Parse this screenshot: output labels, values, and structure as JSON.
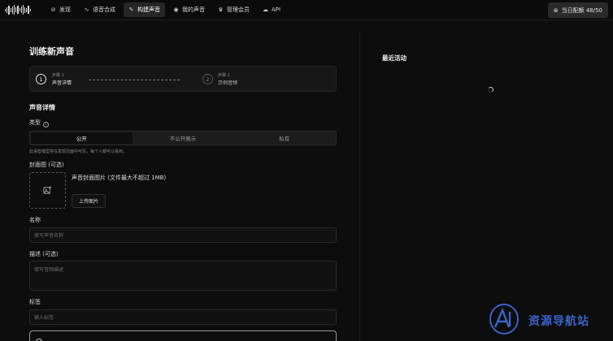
{
  "nav": {
    "items": [
      {
        "label": "发现",
        "icon": "compass-icon",
        "active": false
      },
      {
        "label": "语音合成",
        "icon": "waveform-icon",
        "active": false
      },
      {
        "label": "构建声音",
        "icon": "wand-icon",
        "active": true
      },
      {
        "label": "我的声音",
        "icon": "voices-icon",
        "active": false
      },
      {
        "label": "管理会员",
        "icon": "crown-icon",
        "active": false
      },
      {
        "label": "API",
        "icon": "cloud-icon",
        "active": false
      }
    ],
    "quota": "当日配额 48/50"
  },
  "page": {
    "title": "训练新声音",
    "steps": [
      {
        "number": "1",
        "step_label": "步骤 1",
        "name": "声音详情",
        "active": true
      },
      {
        "number": "2",
        "step_label": "步骤 2",
        "name": "示例音频",
        "active": false
      }
    ]
  },
  "details": {
    "section_title": "声音详情",
    "type_label": "类型",
    "type_options": [
      "公开",
      "不公开展示",
      "私有"
    ],
    "type_selected": "公开",
    "type_hint": "此语音模型将在发现页面中可见，每个人都可以看到。",
    "cover_label": "封面图 (可选)",
    "cover_title": "声音封面图片 (文件最大不超过 1MB)",
    "upload_button": "上传图片",
    "name_label": "名称",
    "name_placeholder": "填写声音名称",
    "desc_label": "描述 (可选)",
    "desc_placeholder": "填写音频描述",
    "tags_label": "标签",
    "tags_placeholder": "输入标签"
  },
  "recent": {
    "title": "最近活动"
  },
  "colors": {
    "background": "#0d0d0d",
    "watermark": "#3b63c9"
  }
}
